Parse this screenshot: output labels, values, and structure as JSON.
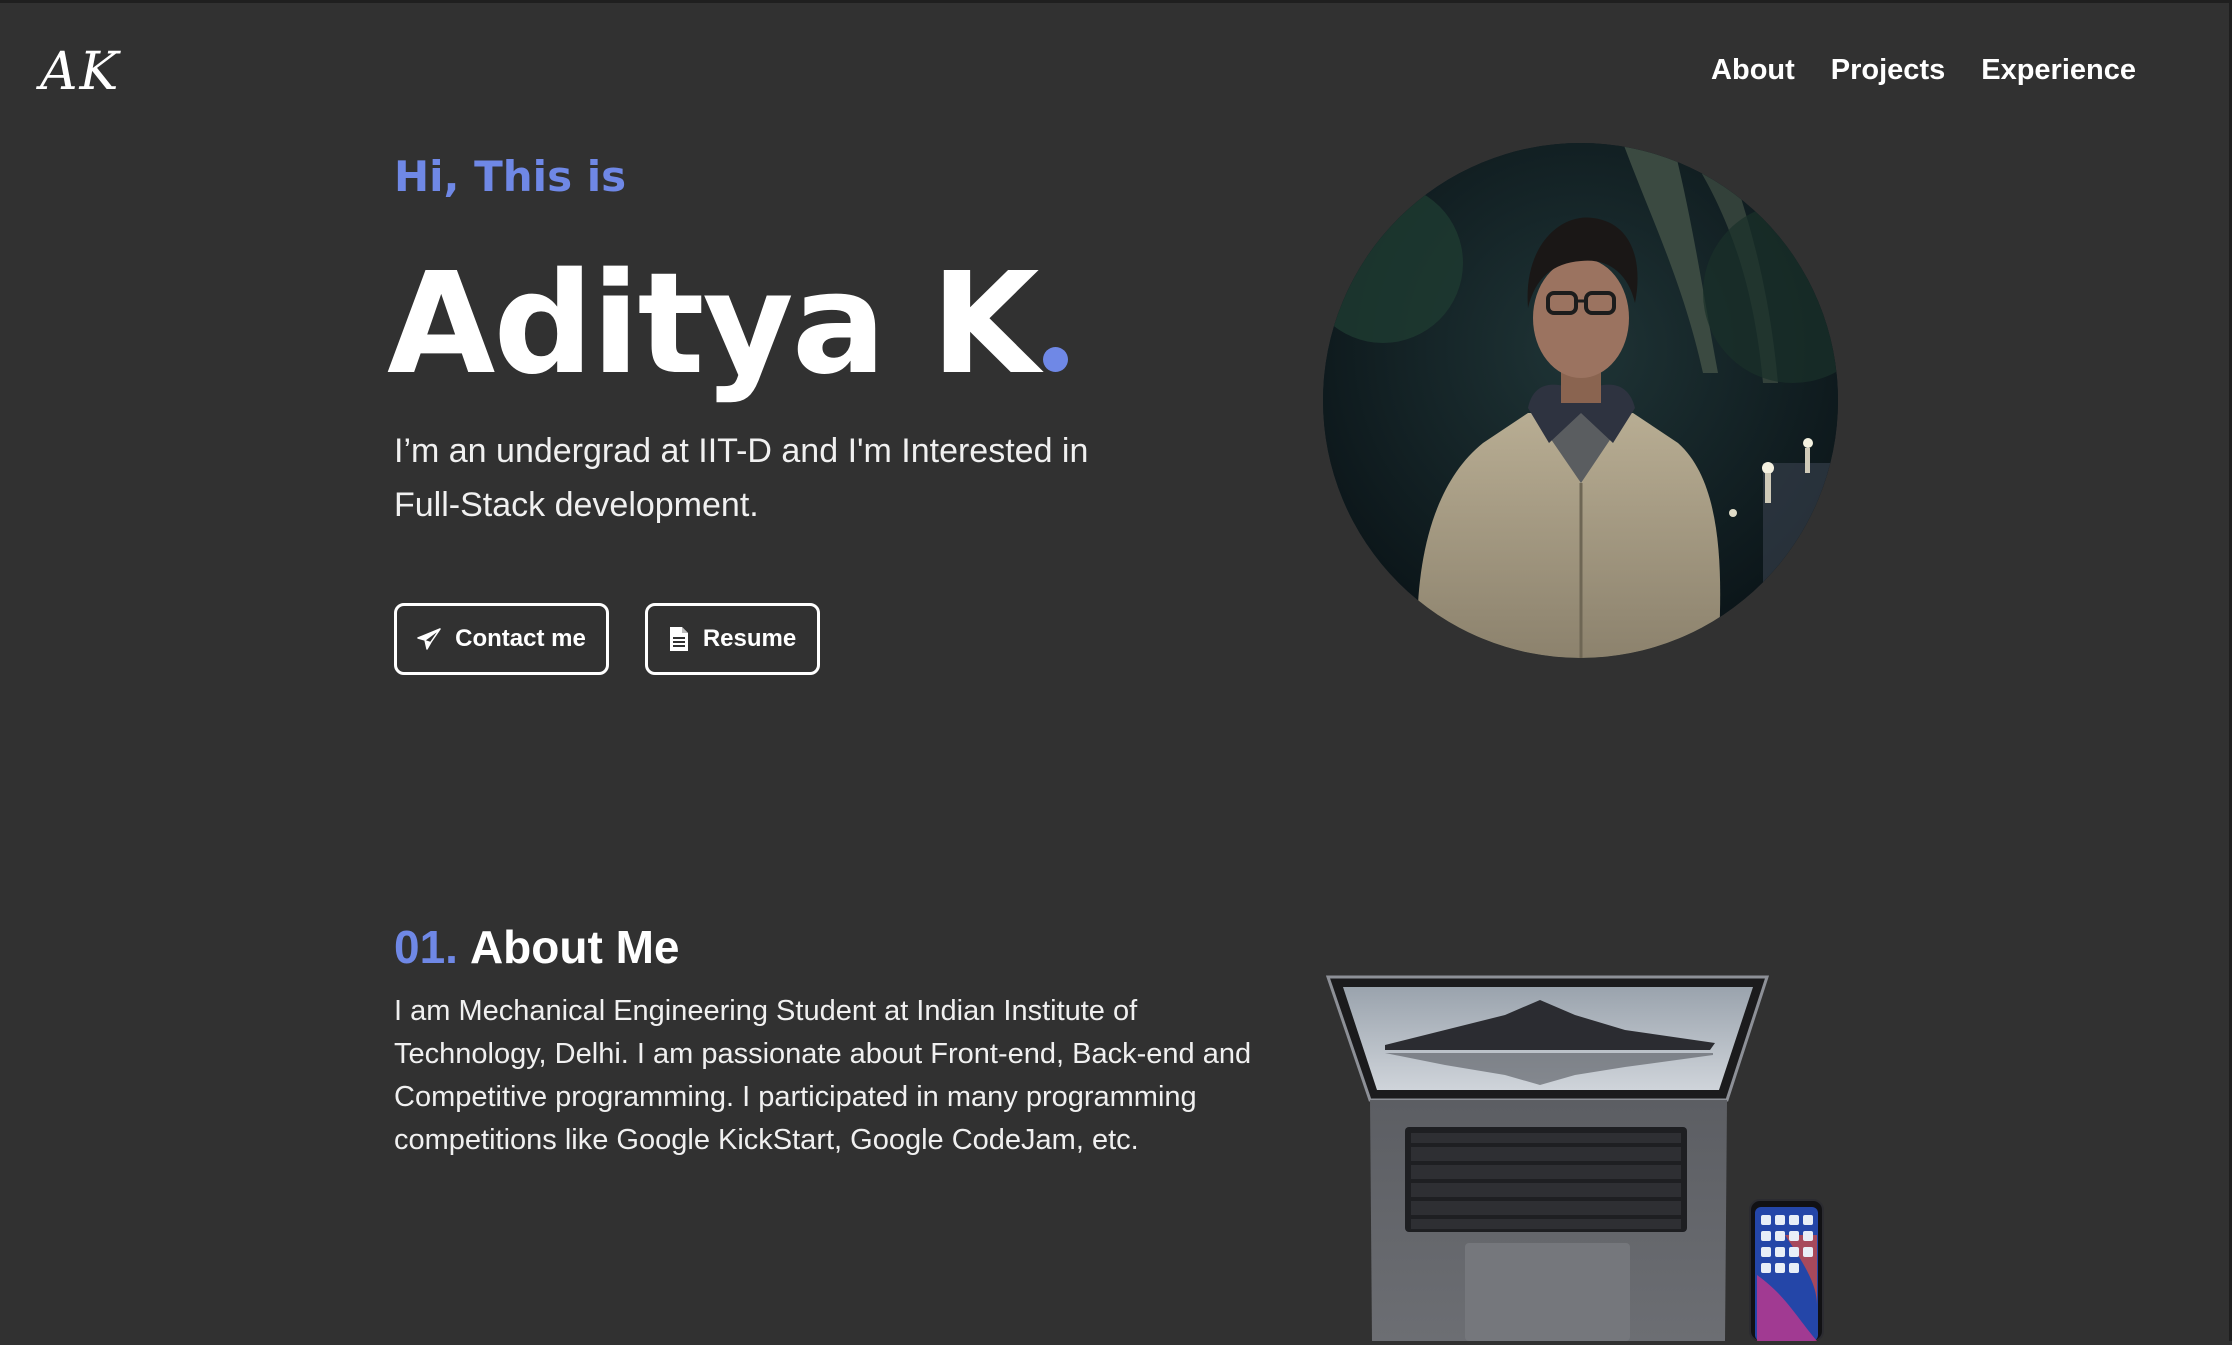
{
  "header": {
    "logo_text": "AK",
    "nav": [
      {
        "label": "About"
      },
      {
        "label": "Projects"
      },
      {
        "label": "Experience"
      }
    ]
  },
  "hero": {
    "greeting": "Hi, This is",
    "name": "Aditya K",
    "tagline": "I’m an undergrad at IIT-D and I'm Interested in Full-Stack development.",
    "contact_label": "Contact me",
    "resume_label": "Resume",
    "accent_color": "#6f88e6",
    "photo_icon": "profile-photo"
  },
  "about": {
    "number": "01.",
    "title": "About Me",
    "text": "I am Mechanical Engineering Student at Indian Institute of Technology, Delhi. I am passionate about Front-end, Back-end and Competitive programming. I participated in many programming competitions like Google KickStart, Google CodeJam, etc."
  }
}
